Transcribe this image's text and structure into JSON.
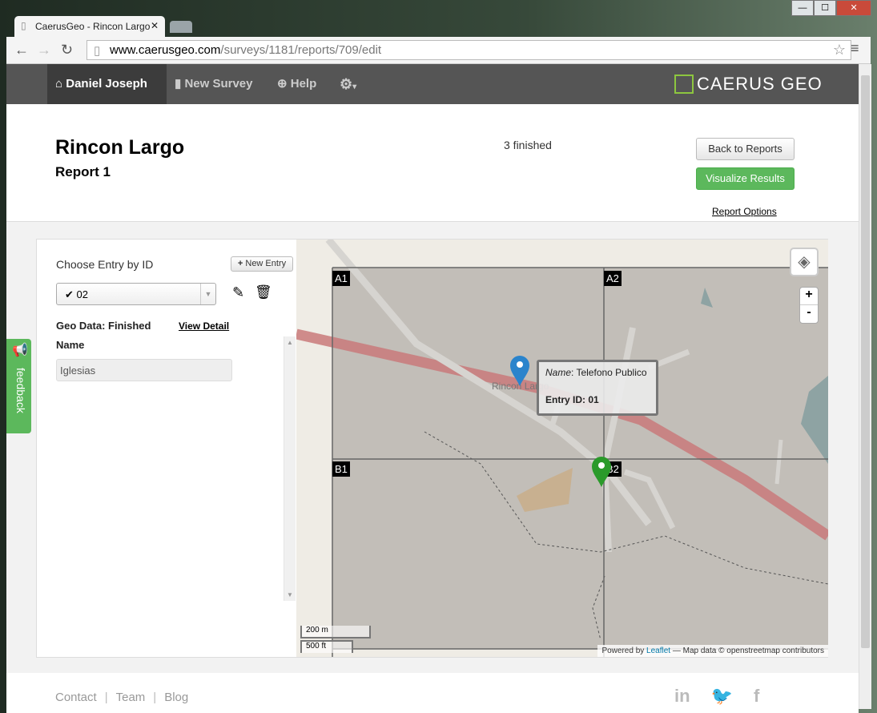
{
  "browser": {
    "tab_title": "CaerusGeo - Rincon Largo",
    "url_host": "www.caerusgeo.com",
    "url_path": "/surveys/1181/reports/709/edit"
  },
  "navbar": {
    "user": "Daniel Joseph",
    "new_survey": "New Survey",
    "help": "Help",
    "brand": "CAERUS GEO"
  },
  "header": {
    "title": "Rincon Largo",
    "subtitle": "Report 1",
    "status": "3 finished",
    "back_button": "Back to Reports",
    "visualize_button": "Visualize Results",
    "options_link": "Report Options"
  },
  "sidebar": {
    "choose_label": "Choose Entry by ID",
    "new_entry": "New Entry",
    "selected_entry": "02",
    "geo_status": "Geo Data: Finished",
    "view_detail": "View Detail",
    "field_label": "Name",
    "field_value": "Iglesias",
    "feedback": "feedback"
  },
  "map": {
    "grid_labels": [
      "A1",
      "A2",
      "B1",
      "B2"
    ],
    "place_label": "Rincon Largo",
    "popup": {
      "name_key": "Name",
      "name_value": ": Telefono Publico",
      "entry_id": "Entry ID: 01"
    },
    "scale_m": "200 m",
    "scale_ft": "500 ft",
    "attribution_prefix": "Powered by ",
    "attribution_link": "Leaflet",
    "attribution_suffix": " — Map data © openstreetmap contributors",
    "zoom_in": "+",
    "zoom_out": "-",
    "marker_colors": {
      "entry_01": "#2a84cc",
      "entry_02": "#2a9a2a"
    }
  },
  "footer": {
    "links": [
      "Contact",
      "Team",
      "Blog"
    ]
  },
  "colors": {
    "accent_green": "#5cb85c",
    "navbar": "#555555",
    "brand": "#8dc63f"
  }
}
